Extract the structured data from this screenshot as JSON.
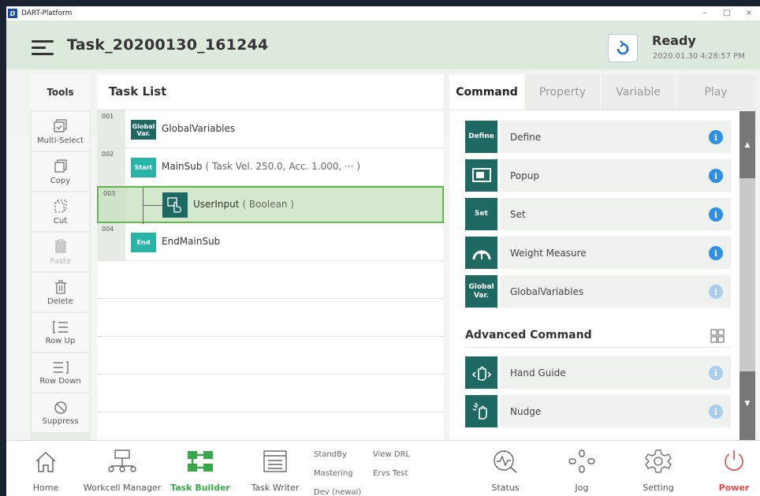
{
  "window": {
    "title": "DART-Platform",
    "controls": [
      "–",
      "□",
      "×"
    ]
  },
  "header": {
    "task_title": "Task_20200130_161244",
    "status": "Ready",
    "timestamp": "2020.01.30 4:28:57 PM"
  },
  "tools": {
    "title": "Tools",
    "items": [
      {
        "label": "Multi-Select",
        "icon": "multi-select-icon",
        "enabled": true
      },
      {
        "label": "Copy",
        "icon": "copy-icon",
        "enabled": true
      },
      {
        "label": "Cut",
        "icon": "cut-icon",
        "enabled": true
      },
      {
        "label": "Paste",
        "icon": "paste-icon",
        "enabled": false
      },
      {
        "label": "Delete",
        "icon": "trash-icon",
        "enabled": true
      },
      {
        "label": "Row Up",
        "icon": "row-up-icon",
        "enabled": true
      },
      {
        "label": "Row Down",
        "icon": "row-down-icon",
        "enabled": true
      },
      {
        "label": "Suppress",
        "icon": "suppress-icon",
        "enabled": true
      }
    ]
  },
  "tasklist": {
    "title": "Task List",
    "rows": [
      {
        "num": "001",
        "badge": "Global Var.",
        "label": "GlobalVariables",
        "param": ""
      },
      {
        "num": "002",
        "badge": "Start",
        "label": "MainSub",
        "param": "( Task Vel. 250.0, Acc. 1.000, ··· )"
      },
      {
        "num": "003",
        "badge": "",
        "label": "UserInput",
        "param": "( Boolean )"
      },
      {
        "num": "004",
        "badge": "End",
        "label": "EndMainSub",
        "param": ""
      }
    ]
  },
  "command_panel": {
    "tabs": [
      "Command",
      "Property",
      "Variable",
      "Play"
    ],
    "active_tab": "Command",
    "commands": [
      {
        "icon_text": "Define",
        "label": "Define"
      },
      {
        "icon_text": "",
        "label": "Popup"
      },
      {
        "icon_text": "Set",
        "label": "Set"
      },
      {
        "icon_text": "",
        "label": "Weight Measure"
      },
      {
        "icon_text": "Global Var.",
        "label": "GlobalVariables"
      }
    ],
    "advanced_title": "Advanced Command",
    "advanced": [
      {
        "label": "Hand Guide"
      },
      {
        "label": "Nudge"
      }
    ],
    "info_glyph": "i"
  },
  "bottom_nav": {
    "home": "Home",
    "workcell": "Workcell Manager",
    "task_builder": "Task Builder",
    "task_writer": "Task Writer",
    "standby": "StandBy",
    "mastering": "Mastering",
    "dev": "Dev (newal)",
    "view_drl": "View DRL",
    "ervs_test": "Ervs Test",
    "status": "Status",
    "jog": "Jog",
    "setting": "Setting",
    "power": "Power"
  },
  "colors": {
    "accent_green": "#3aa64b",
    "command_teal": "#1e6a62",
    "badge_teal": "#28b5a7",
    "info_blue": "#2f8ee6",
    "power_red": "#e34848"
  }
}
